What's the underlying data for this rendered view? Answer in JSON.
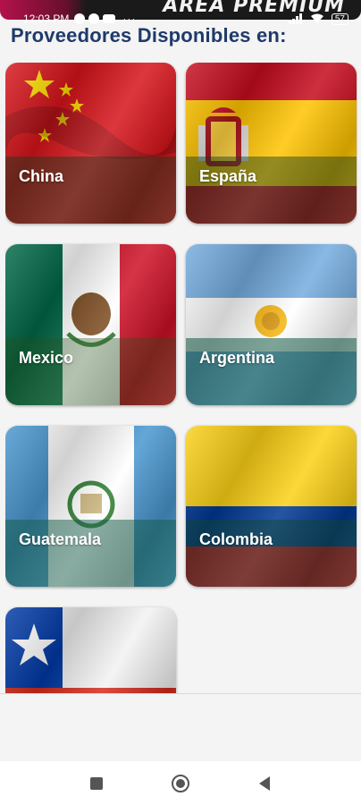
{
  "banner": {
    "text": "AREA PREMIUM"
  },
  "status_bar": {
    "time": "12:03 PM",
    "overflow": "···",
    "battery": "57"
  },
  "page": {
    "title": "Proveedores Disponibles en:"
  },
  "countries": [
    {
      "label": "China",
      "icon": "china-flag"
    },
    {
      "label": "España",
      "icon": "spain-flag"
    },
    {
      "label": "Mexico",
      "icon": "mexico-flag"
    },
    {
      "label": "Argentina",
      "icon": "argentina-flag"
    },
    {
      "label": "Guatemala",
      "icon": "guatemala-flag"
    },
    {
      "label": "Colombia",
      "icon": "colombia-flag"
    },
    {
      "label": "",
      "icon": "chile-flag"
    }
  ],
  "colors": {
    "title": "#1f3a6b",
    "china_red": "#d7141a",
    "spain_red": "#c60b1e",
    "spain_yellow": "#ffc400",
    "mexico_green": "#006847",
    "mexico_red": "#ce1126",
    "argentina_blue": "#74acdf",
    "guatemala_blue": "#4997d0",
    "colombia_yellow": "#fcd116",
    "colombia_blue": "#003893",
    "colombia_red": "#ce1126",
    "chile_blue": "#0039a6",
    "chile_red": "#d52b1e"
  },
  "nav": {
    "recents": "square-icon",
    "home": "circle-icon",
    "back": "back-triangle-icon"
  }
}
